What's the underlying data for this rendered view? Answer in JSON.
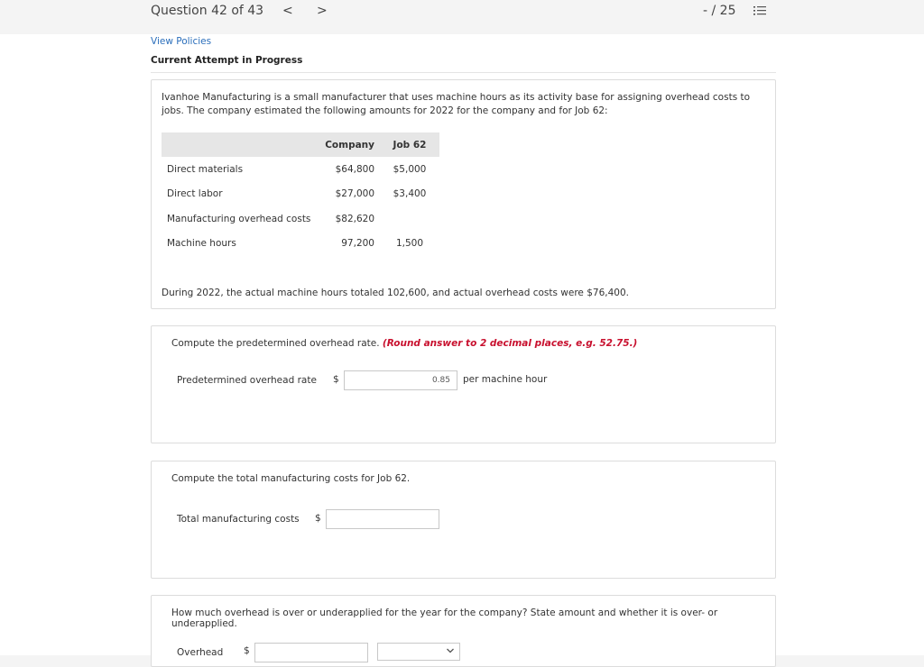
{
  "header": {
    "question": "Question 42 of 43",
    "prev_icon": "chevron-left-icon",
    "prev_glyph": "<",
    "next_icon": "chevron-right-icon",
    "next_glyph": ">",
    "score": "- / 25",
    "list_icon": "list-icon"
  },
  "subheader": {
    "policies_link": "View Policies",
    "attempt_status": "Current Attempt in Progress"
  },
  "problem": {
    "intro": "Ivanhoe Manufacturing is a small manufacturer that uses machine hours as its activity base for assigning overhead costs to jobs. The company estimated the following amounts for 2022 for the company and for Job 62:",
    "table": {
      "headers": [
        "",
        "Company",
        "Job 62"
      ],
      "rows": [
        [
          "Direct materials",
          "$64,800",
          "$5,000"
        ],
        [
          "Direct labor",
          "$27,000",
          "$3,400"
        ],
        [
          "Manufacturing overhead costs",
          "$82,620",
          ""
        ],
        [
          "Machine hours",
          "97,200",
          "1,500"
        ]
      ]
    },
    "actual": "During 2022, the actual machine hours totaled 102,600, and actual overhead costs were $76,400."
  },
  "q1": {
    "prompt": "Compute the predetermined overhead rate.",
    "hint": "(Round answer to 2 decimal places, e.g. 52.75.)",
    "label": "Predetermined overhead rate",
    "currency": "$",
    "value": "0.85",
    "unit": "per machine hour"
  },
  "q2": {
    "prompt": "Compute the total manufacturing costs for Job 62.",
    "label": "Total manufacturing costs",
    "currency": "$",
    "value": ""
  },
  "q3": {
    "prompt": "How much overhead is over or underapplied for the year for the company? State amount and whether it is over- or underapplied.",
    "label": "Overhead",
    "currency": "$",
    "value": "",
    "select_value": ""
  }
}
